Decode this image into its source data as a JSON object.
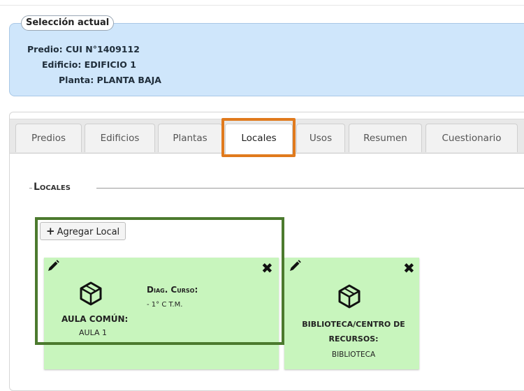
{
  "selection": {
    "legend": "Selección actual",
    "predio": "Predio: CUI N°1409112",
    "edificio": "Edificio: EDIFICIO 1",
    "planta": "Planta: PLANTA BAJA"
  },
  "tabs": [
    {
      "label": "Predios"
    },
    {
      "label": "Edificios"
    },
    {
      "label": "Plantas"
    },
    {
      "label": "Locales"
    },
    {
      "label": "Usos"
    },
    {
      "label": "Resumen"
    },
    {
      "label": "Cuestionario"
    }
  ],
  "active_tab": "Locales",
  "locales": {
    "legend": "Locales",
    "add_button": "Agregar Local",
    "cards": [
      {
        "type": "AULA COMÚN:",
        "name": "AULA 1",
        "diag_label": "Diag. Curso:",
        "diag_value": "- 1° C T.M."
      },
      {
        "type_line1": "BIBLIOTECA/CENTRO DE",
        "type_line2": "RECURSOS:",
        "name": "BIBLIOTECA"
      }
    ]
  },
  "colors": {
    "selection_bg": "#cfe6fb",
    "card_bg": "#c8f5bd",
    "tab_highlight": "#e07a1d",
    "card_highlight": "#4c7a2e"
  },
  "icons": [
    "edit-pencil-icon",
    "delete-x-icon",
    "cube-icon",
    "plus-icon"
  ]
}
